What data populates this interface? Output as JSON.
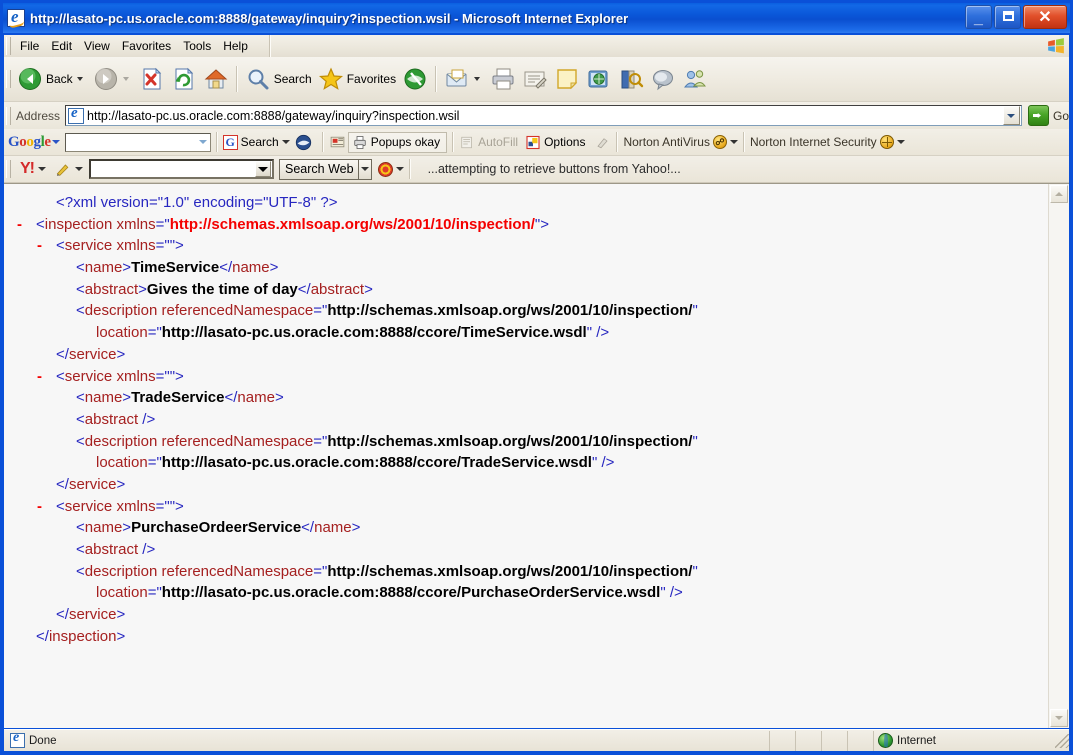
{
  "window": {
    "title": "http://lasato-pc.us.oracle.com:8888/gateway/inquiry?inspection.wsil - Microsoft Internet Explorer",
    "icon": "ie-document-icon",
    "buttons": {
      "minimize": "_",
      "maximize": "□",
      "close": "✕"
    }
  },
  "menubar": {
    "items": [
      {
        "label": "File"
      },
      {
        "label": "Edit"
      },
      {
        "label": "View"
      },
      {
        "label": "Favorites"
      },
      {
        "label": "Tools"
      },
      {
        "label": "Help"
      }
    ]
  },
  "toolbar": {
    "back_label": "Back",
    "forward_label": "",
    "search_label": "Search",
    "favorites_label": "Favorites",
    "icons": [
      "back-arrow-icon",
      "forward-arrow-icon",
      "stop-icon",
      "refresh-icon",
      "home-icon",
      "search-magnifier-icon",
      "favorites-star-icon",
      "media-icon",
      "mail-icon",
      "print-icon",
      "edit-icon",
      "notes-icon",
      "discuss-globe-icon",
      "research-icon",
      "messenger-icon",
      "people-icon"
    ]
  },
  "address": {
    "label": "Address",
    "value": "http://lasato-pc.us.oracle.com:8888/gateway/inquiry?inspection.wsil",
    "placeholder": "",
    "go_label": "Go"
  },
  "google_toolbar": {
    "logo": {
      "g1": "G",
      "o1": "o",
      "o2": "o",
      "g2": "g",
      "l": "l",
      "e": "e"
    },
    "search_value": "",
    "search_placeholder": "",
    "search_label": "Search",
    "popups_label": "Popups okay",
    "autofill_label": "AutoFill",
    "options_label": "Options",
    "norton_antivirus_label": "Norton AntiVirus",
    "norton_internet_security_label": "Norton Internet Security"
  },
  "yahoo_toolbar": {
    "logo": "Y!",
    "search_value": "",
    "search_placeholder": "",
    "search_button_label": "Search Web",
    "status_text": "...attempting to retrieve buttons from Yahoo!..."
  },
  "xml_document": {
    "lines": [
      {
        "indent": 1,
        "minus": false,
        "tokens": [
          {
            "t": "<?xml version=",
            "c": "tk-decl"
          },
          {
            "t": "\"1.0\"",
            "c": "tk-decl"
          },
          {
            "t": " encoding=",
            "c": "tk-decl"
          },
          {
            "t": "\"UTF-8\"",
            "c": "tk-decl"
          },
          {
            "t": " ?>",
            "c": "tk-decl"
          }
        ]
      },
      {
        "indent": 0,
        "minus": true,
        "tokens": [
          {
            "t": "<",
            "c": "tk-tag"
          },
          {
            "t": "inspection",
            "c": "tk-name"
          },
          {
            "t": " ",
            "c": "tk-name"
          },
          {
            "t": "xmlns",
            "c": "tk-attr"
          },
          {
            "t": "=",
            "c": "tk-eq"
          },
          {
            "t": "\"",
            "c": "tk-qt"
          },
          {
            "t": "http://schemas.xmlsoap.org/ws/2001/10/inspection/",
            "c": "tk-valr"
          },
          {
            "t": "\"",
            "c": "tk-qt"
          },
          {
            "t": ">",
            "c": "tk-tag"
          }
        ]
      },
      {
        "indent": 1,
        "minus": true,
        "tokens": [
          {
            "t": "<",
            "c": "tk-tag"
          },
          {
            "t": "service",
            "c": "tk-name"
          },
          {
            "t": " ",
            "c": "tk-name"
          },
          {
            "t": "xmlns",
            "c": "tk-attr"
          },
          {
            "t": "=",
            "c": "tk-eq"
          },
          {
            "t": "\"\"",
            "c": "tk-qt"
          },
          {
            "t": ">",
            "c": "tk-tag"
          }
        ]
      },
      {
        "indent": 2,
        "minus": false,
        "tokens": [
          {
            "t": "<",
            "c": "tk-tag"
          },
          {
            "t": "name",
            "c": "tk-name"
          },
          {
            "t": ">",
            "c": "tk-tag"
          },
          {
            "t": "TimeService",
            "c": "tk-txt"
          },
          {
            "t": "</",
            "c": "tk-tag"
          },
          {
            "t": "name",
            "c": "tk-name"
          },
          {
            "t": ">",
            "c": "tk-tag"
          }
        ]
      },
      {
        "indent": 2,
        "minus": false,
        "tokens": [
          {
            "t": "<",
            "c": "tk-tag"
          },
          {
            "t": "abstract",
            "c": "tk-name"
          },
          {
            "t": ">",
            "c": "tk-tag"
          },
          {
            "t": "Gives the time of day",
            "c": "tk-txt"
          },
          {
            "t": "</",
            "c": "tk-tag"
          },
          {
            "t": "abstract",
            "c": "tk-name"
          },
          {
            "t": ">",
            "c": "tk-tag"
          }
        ]
      },
      {
        "indent": 2,
        "minus": false,
        "tokens": [
          {
            "t": "<",
            "c": "tk-tag"
          },
          {
            "t": "description",
            "c": "tk-name"
          },
          {
            "t": " ",
            "c": "tk-name"
          },
          {
            "t": "referencedNamespace",
            "c": "tk-attr"
          },
          {
            "t": "=",
            "c": "tk-eq"
          },
          {
            "t": "\"",
            "c": "tk-qt"
          },
          {
            "t": "http://schemas.xmlsoap.org/ws/2001/10/inspection/",
            "c": "tk-valk"
          },
          {
            "t": "\"",
            "c": "tk-qt"
          }
        ]
      },
      {
        "indent": 3,
        "minus": false,
        "tokens": [
          {
            "t": "location",
            "c": "tk-attr"
          },
          {
            "t": "=",
            "c": "tk-eq"
          },
          {
            "t": "\"",
            "c": "tk-qt"
          },
          {
            "t": "http://lasato-pc.us.oracle.com:8888/ccore/TimeService.wsdl",
            "c": "tk-valk"
          },
          {
            "t": "\"",
            "c": "tk-qt"
          },
          {
            "t": " />",
            "c": "tk-tag"
          }
        ]
      },
      {
        "indent": 1,
        "minus": false,
        "tokens": [
          {
            "t": "</",
            "c": "tk-tag"
          },
          {
            "t": "service",
            "c": "tk-name"
          },
          {
            "t": ">",
            "c": "tk-tag"
          }
        ]
      },
      {
        "indent": 1,
        "minus": true,
        "tokens": [
          {
            "t": "<",
            "c": "tk-tag"
          },
          {
            "t": "service",
            "c": "tk-name"
          },
          {
            "t": " ",
            "c": "tk-name"
          },
          {
            "t": "xmlns",
            "c": "tk-attr"
          },
          {
            "t": "=",
            "c": "tk-eq"
          },
          {
            "t": "\"\"",
            "c": "tk-qt"
          },
          {
            "t": ">",
            "c": "tk-tag"
          }
        ]
      },
      {
        "indent": 2,
        "minus": false,
        "tokens": [
          {
            "t": "<",
            "c": "tk-tag"
          },
          {
            "t": "name",
            "c": "tk-name"
          },
          {
            "t": ">",
            "c": "tk-tag"
          },
          {
            "t": "TradeService",
            "c": "tk-txt"
          },
          {
            "t": "</",
            "c": "tk-tag"
          },
          {
            "t": "name",
            "c": "tk-name"
          },
          {
            "t": ">",
            "c": "tk-tag"
          }
        ]
      },
      {
        "indent": 2,
        "minus": false,
        "tokens": [
          {
            "t": "<",
            "c": "tk-tag"
          },
          {
            "t": "abstract",
            "c": "tk-name"
          },
          {
            "t": " />",
            "c": "tk-tag"
          }
        ]
      },
      {
        "indent": 2,
        "minus": false,
        "tokens": [
          {
            "t": "<",
            "c": "tk-tag"
          },
          {
            "t": "description",
            "c": "tk-name"
          },
          {
            "t": " ",
            "c": "tk-name"
          },
          {
            "t": "referencedNamespace",
            "c": "tk-attr"
          },
          {
            "t": "=",
            "c": "tk-eq"
          },
          {
            "t": "\"",
            "c": "tk-qt"
          },
          {
            "t": "http://schemas.xmlsoap.org/ws/2001/10/inspection/",
            "c": "tk-valk"
          },
          {
            "t": "\"",
            "c": "tk-qt"
          }
        ]
      },
      {
        "indent": 3,
        "minus": false,
        "tokens": [
          {
            "t": "location",
            "c": "tk-attr"
          },
          {
            "t": "=",
            "c": "tk-eq"
          },
          {
            "t": "\"",
            "c": "tk-qt"
          },
          {
            "t": "http://lasato-pc.us.oracle.com:8888/ccore/TradeService.wsdl",
            "c": "tk-valk"
          },
          {
            "t": "\"",
            "c": "tk-qt"
          },
          {
            "t": " />",
            "c": "tk-tag"
          }
        ]
      },
      {
        "indent": 1,
        "minus": false,
        "tokens": [
          {
            "t": "</",
            "c": "tk-tag"
          },
          {
            "t": "service",
            "c": "tk-name"
          },
          {
            "t": ">",
            "c": "tk-tag"
          }
        ]
      },
      {
        "indent": 1,
        "minus": true,
        "tokens": [
          {
            "t": "<",
            "c": "tk-tag"
          },
          {
            "t": "service",
            "c": "tk-name"
          },
          {
            "t": " ",
            "c": "tk-name"
          },
          {
            "t": "xmlns",
            "c": "tk-attr"
          },
          {
            "t": "=",
            "c": "tk-eq"
          },
          {
            "t": "\"\"",
            "c": "tk-qt"
          },
          {
            "t": ">",
            "c": "tk-tag"
          }
        ]
      },
      {
        "indent": 2,
        "minus": false,
        "tokens": [
          {
            "t": "<",
            "c": "tk-tag"
          },
          {
            "t": "name",
            "c": "tk-name"
          },
          {
            "t": ">",
            "c": "tk-tag"
          },
          {
            "t": "PurchaseOrdeerService",
            "c": "tk-txt"
          },
          {
            "t": "</",
            "c": "tk-tag"
          },
          {
            "t": "name",
            "c": "tk-name"
          },
          {
            "t": ">",
            "c": "tk-tag"
          }
        ]
      },
      {
        "indent": 2,
        "minus": false,
        "tokens": [
          {
            "t": "<",
            "c": "tk-tag"
          },
          {
            "t": "abstract",
            "c": "tk-name"
          },
          {
            "t": " />",
            "c": "tk-tag"
          }
        ]
      },
      {
        "indent": 2,
        "minus": false,
        "tokens": [
          {
            "t": "<",
            "c": "tk-tag"
          },
          {
            "t": "description",
            "c": "tk-name"
          },
          {
            "t": " ",
            "c": "tk-name"
          },
          {
            "t": "referencedNamespace",
            "c": "tk-attr"
          },
          {
            "t": "=",
            "c": "tk-eq"
          },
          {
            "t": "\"",
            "c": "tk-qt"
          },
          {
            "t": "http://schemas.xmlsoap.org/ws/2001/10/inspection/",
            "c": "tk-valk"
          },
          {
            "t": "\"",
            "c": "tk-qt"
          }
        ]
      },
      {
        "indent": 3,
        "minus": false,
        "tokens": [
          {
            "t": "location",
            "c": "tk-attr"
          },
          {
            "t": "=",
            "c": "tk-eq"
          },
          {
            "t": "\"",
            "c": "tk-qt"
          },
          {
            "t": "http://lasato-pc.us.oracle.com:8888/ccore/PurchaseOrderService.wsdl",
            "c": "tk-valk"
          },
          {
            "t": "\"",
            "c": "tk-qt"
          },
          {
            "t": " />",
            "c": "tk-tag"
          }
        ]
      },
      {
        "indent": 1,
        "minus": false,
        "tokens": [
          {
            "t": "</",
            "c": "tk-tag"
          },
          {
            "t": "service",
            "c": "tk-name"
          },
          {
            "t": ">",
            "c": "tk-tag"
          }
        ]
      },
      {
        "indent": 0,
        "minus": false,
        "tokens": [
          {
            "t": "</",
            "c": "tk-tag"
          },
          {
            "t": "inspection",
            "c": "tk-name"
          },
          {
            "t": ">",
            "c": "tk-tag"
          }
        ]
      }
    ]
  },
  "statusbar": {
    "status_text": "Done",
    "zone_text": "Internet",
    "zone_icon": "internet-globe-icon"
  },
  "colors": {
    "title_blue": "#0a56d8",
    "chrome": "#ece8dd",
    "content_bg": "#f7f7f7",
    "xml_tag": "#2727c0",
    "xml_name": "#a52020",
    "xml_value_red": "#f40000",
    "xml_text": "#000000"
  }
}
